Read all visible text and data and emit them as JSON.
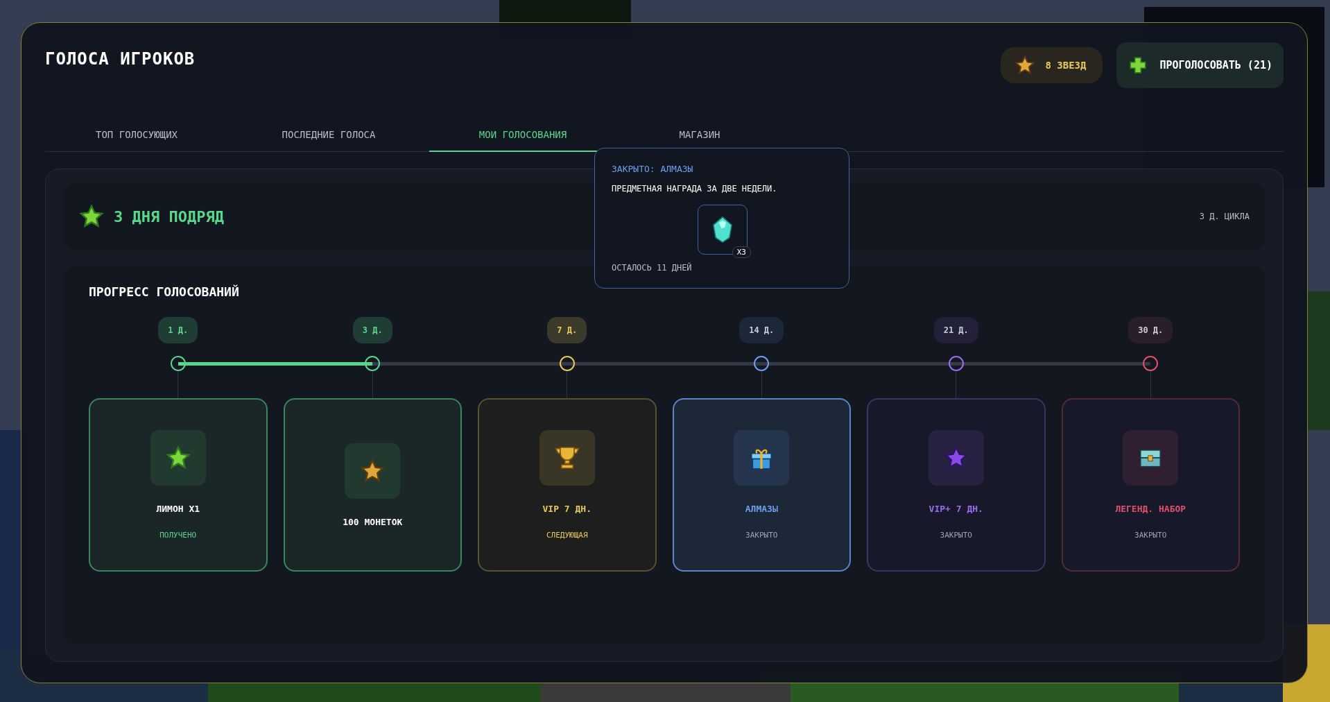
{
  "window": {
    "title": "ГОЛОСА ИГРОКОВ"
  },
  "stars_badge": {
    "label": "8 ЗВЕЗД"
  },
  "vote_button": {
    "label": "ПРОГОЛОСОВАТЬ (21)"
  },
  "tabs": [
    {
      "label": "ТОП ГОЛОСУЮЩИХ",
      "selected": false
    },
    {
      "label": "ПОСЛЕДНИЕ ГОЛОСА",
      "selected": false
    },
    {
      "label": "МОИ ГОЛОСОВАНИЯ",
      "selected": true
    },
    {
      "label": "МАГАЗИН",
      "selected": false
    }
  ],
  "streak": {
    "title": "3 ДНЯ ПОДРЯД",
    "cycle": "3 Д. ЦИКЛА"
  },
  "progress": {
    "title": "ПРОГРЕСС ГОЛОСОВАНИЙ",
    "level": 0.2,
    "milestones": [
      {
        "day": "1 Д.",
        "title": "ЛИМОН X1",
        "status": "ПОЛУЧЕНО",
        "kind": "claimed",
        "color": "#5ad68a"
      },
      {
        "day": "3 Д.",
        "title": "100 МОНЕТОК",
        "kind": "claimed",
        "color": "#5ad68a"
      },
      {
        "day": "7 Д.",
        "title": "VIP 7 ДН.",
        "status": "СЛЕДУЮЩАЯ",
        "kind": "next",
        "color": "#e8c85a"
      },
      {
        "day": "14 Д.",
        "title": "АЛМАЗЫ",
        "status": "ЗАКРЫТО",
        "kind": "locked",
        "color": "#6d9ef0"
      },
      {
        "day": "21 Д.",
        "title": "VIP+ 7 ДН.",
        "status": "ЗАКРЫТО",
        "kind": "locked",
        "color": "#9a6cf0"
      },
      {
        "day": "30 Д.",
        "title": "ЛЕГЕНД. НАБОР",
        "status": "ЗАКРЫТО",
        "kind": "locked",
        "color": "#e0506a"
      }
    ]
  },
  "tooltip": {
    "title": "ЗАКРЫТО: АЛМАЗЫ",
    "description": "ПРЕДМЕТНАЯ НАГРАДА ЗА ДВЕ НЕДЕЛИ.",
    "count": "X3",
    "remaining": "ОСТАЛОСЬ 11 ДНЕЙ"
  }
}
